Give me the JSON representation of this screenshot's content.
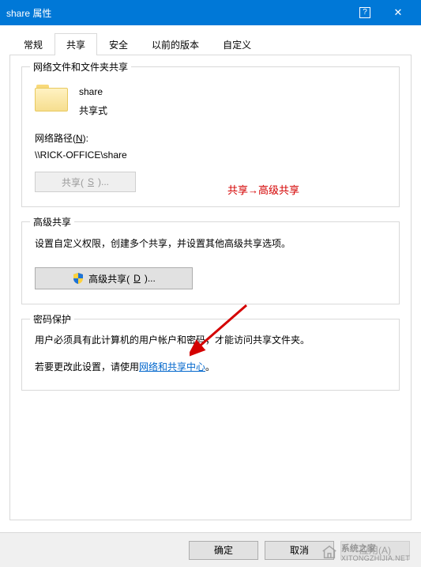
{
  "window": {
    "title": "share 属性"
  },
  "tabs": {
    "general": "常规",
    "share": "共享",
    "security": "安全",
    "previous": "以前的版本",
    "custom": "自定义"
  },
  "group_netshare": {
    "legend": "网络文件和文件夹共享",
    "folder_name": "share",
    "folder_state": "共享式",
    "net_label_prefix": "网络路径(",
    "net_label_key": "N",
    "net_label_suffix": "):",
    "net_path": "\\\\RICK-OFFICE\\share",
    "share_btn_prefix": "共享(",
    "share_btn_key": "S",
    "share_btn_suffix": ")..."
  },
  "annotation1": "共享→高级共享",
  "group_adv": {
    "legend": "高级共享",
    "desc": "设置自定义权限，创建多个共享，并设置其他高级共享选项。",
    "btn_prefix": "高级共享(",
    "btn_key": "D",
    "btn_suffix": ")..."
  },
  "group_pw": {
    "legend": "密码保护",
    "line1": "用户必须具有此计算机的用户帐户和密码，才能访问共享文件夹。",
    "line2_prefix": "若要更改此设置，请使用",
    "link": "网络和共享中心",
    "line2_suffix": "。"
  },
  "footer": {
    "ok": "确定",
    "cancel": "取消",
    "apply": "应用(A)"
  },
  "watermark": {
    "name": "系统之家",
    "url": "XITONGZHIJIA.NET"
  }
}
